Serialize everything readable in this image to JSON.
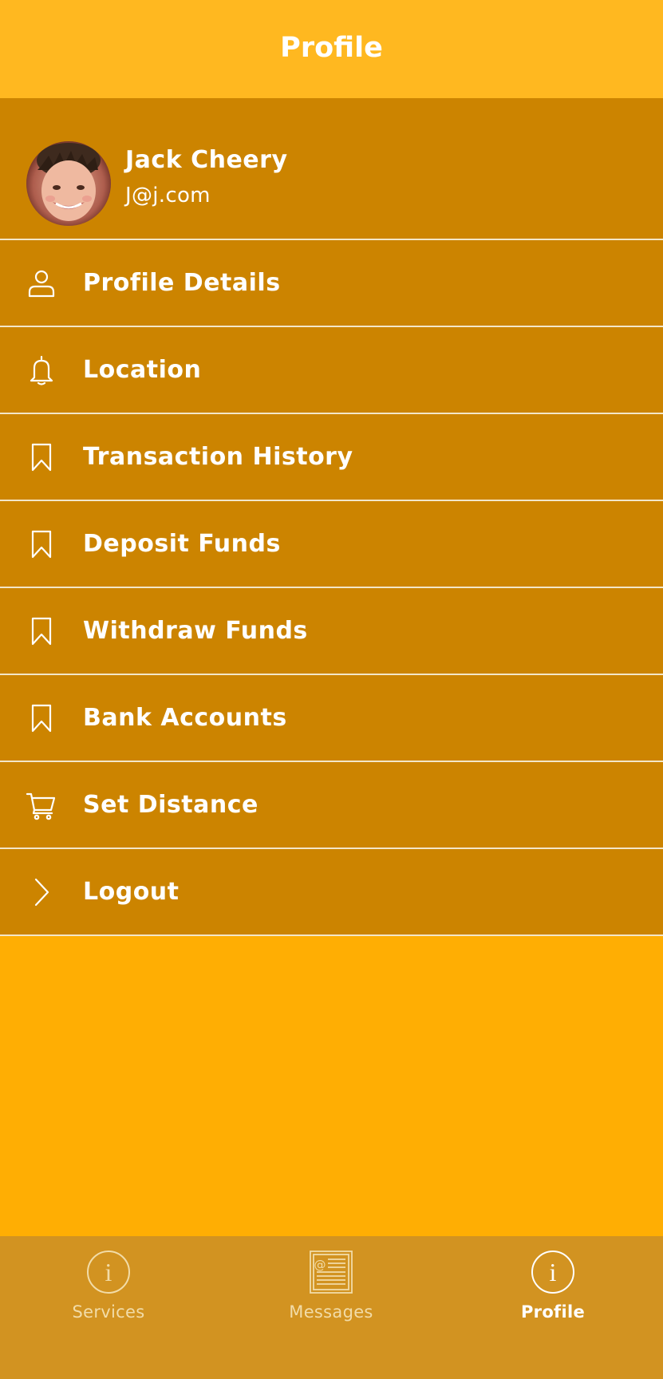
{
  "nav": {
    "title": "Profile"
  },
  "user": {
    "name": "Jack Cheery",
    "email": "J@j.com"
  },
  "menu": {
    "items": [
      {
        "label": "Profile Details",
        "icon": "person-icon"
      },
      {
        "label": "Location",
        "icon": "bell-icon"
      },
      {
        "label": "Transaction History",
        "icon": "bookmark-icon"
      },
      {
        "label": "Deposit Funds",
        "icon": "bookmark-icon"
      },
      {
        "label": "Withdraw Funds",
        "icon": "bookmark-icon"
      },
      {
        "label": "Bank Accounts",
        "icon": "bookmark-icon"
      },
      {
        "label": "Set Distance",
        "icon": "cart-icon"
      },
      {
        "label": "Logout",
        "icon": "chevron-right-icon"
      }
    ]
  },
  "tabbar": {
    "tabs": [
      {
        "label": "Services",
        "icon": "info-icon",
        "active": false
      },
      {
        "label": "Messages",
        "icon": "newspaper-icon",
        "active": false
      },
      {
        "label": "Profile",
        "icon": "info-icon",
        "active": true
      }
    ]
  },
  "colors": {
    "nav_background": "#FFB820",
    "menu_background": "#CC8400",
    "page_background": "#FFAE03",
    "tabbar_background": "#D29321",
    "separator": "#F3E6C8",
    "text": "#FFFFFF"
  }
}
